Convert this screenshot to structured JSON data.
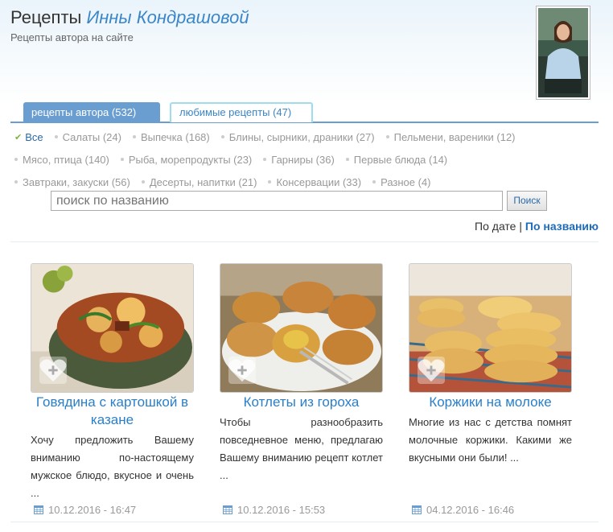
{
  "header": {
    "title_prefix": "Рецепты ",
    "title_name": "Инны Кондрашовой",
    "subtitle": "Рецепты автора на сайте"
  },
  "tabs": [
    {
      "label": "рецепты автора (532)",
      "active": true
    },
    {
      "label": "любимые рецепты (47)",
      "active": false
    }
  ],
  "categories": {
    "row1": [
      "Все",
      "Салаты (24)",
      "Выпечка (168)",
      "Блины, сырники, драники (27)",
      "Пельмени, вареники (12)"
    ],
    "row2": [
      "Мясо, птица (140)",
      "Рыба, морепродукты (23)",
      "Гарниры (36)",
      "Первые блюда (14)"
    ],
    "row3": [
      "Завтраки, закуски (56)",
      "Десерты, напитки (21)",
      "Консервации (33)",
      "Разное (4)"
    ],
    "active": "Все"
  },
  "search": {
    "placeholder": "поиск по названию",
    "button": "Поиск"
  },
  "sort": {
    "by_date": "По дате",
    "separator": "|",
    "by_name": "По названию"
  },
  "recipes": [
    {
      "title": "Говядина с картошкой в казане",
      "description": "Хочу предложить Вашему вниманию по-настоящему мужское блюдо, вкусное и очень ...",
      "date": "10.12.2016 - 16:47"
    },
    {
      "title": "Котлеты из гороха",
      "description": "Чтобы разнообразить повседневное меню, предлагаю Вашему вниманию рецепт котлет ...",
      "date": "10.12.2016 - 15:53"
    },
    {
      "title": "Коржики на молоке",
      "description": "Многие из нас с детства помнят молочные коржики. Какими же вкусными они были! ...",
      "date": "04.12.2016 - 16:46"
    }
  ],
  "colors": {
    "accent": "#2a7fc9",
    "tab_active": "#6b9ed0",
    "tab_border": "#9fdcee"
  },
  "icons": {
    "favorite": "heart-plus-icon",
    "date": "calendar-icon",
    "active_category": "checkmark-icon"
  }
}
